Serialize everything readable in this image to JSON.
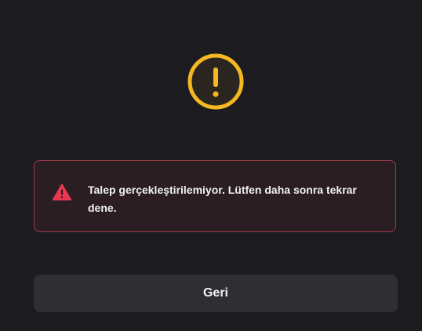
{
  "colors": {
    "background": "#1c1c20",
    "warning_accent": "#f5b820",
    "error_accent": "#e8384f",
    "alert_border": "#a23d4a",
    "alert_background": "#2a1e22",
    "button_background": "#2e2e33"
  },
  "status": {
    "icon": "exclamation-circle-icon"
  },
  "alert": {
    "icon": "warning-triangle-icon",
    "message": "Talep gerçekleştirilemiyor. Lütfen daha sonra tekrar dene."
  },
  "actions": {
    "back_label": "Geri"
  }
}
